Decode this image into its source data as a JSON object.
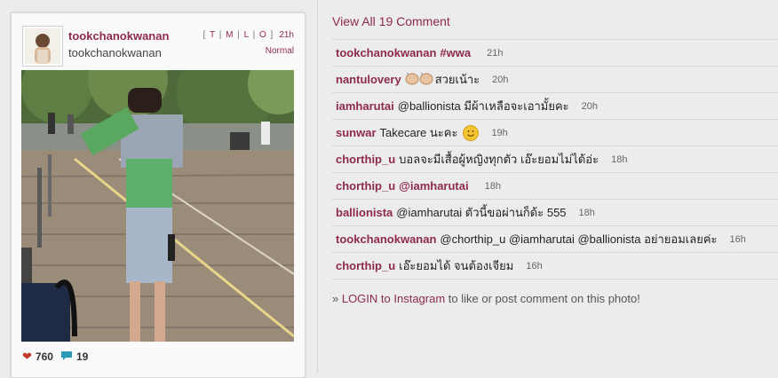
{
  "post": {
    "username": "tookchanokwanan",
    "fullname": "tookchanokwanan",
    "sizes": [
      "T",
      "M",
      "L",
      "O"
    ],
    "time": "21h",
    "filter": "Normal",
    "likes": "760",
    "comments_count": "19"
  },
  "colors": {
    "accent": "#8e2a4d",
    "heart": "#c0392b",
    "bubble": "#2a9bb5"
  },
  "view_all": "View All 19 Comment",
  "comments": [
    {
      "user": "tookchanokwanan",
      "text": "#wwa",
      "time": "21h"
    },
    {
      "user": "nantulovery",
      "text": "สวยเน้าะ",
      "time": "20h",
      "emoji": "clapping-hands-icon"
    },
    {
      "user": "iamharutai",
      "text": "@ballionista มีผ้าเหลือจะเอามั้ยคะ",
      "time": "20h"
    },
    {
      "user": "sunwar",
      "text": "Takecare นะคะ",
      "time": "19h",
      "emoji": "smiley-face-icon"
    },
    {
      "user": "chorthip_u",
      "text": "บอลจะมีเสื้อผู้หญิงทุกตัว เอ๊ะยอมไม่ได้อ่ะ",
      "time": "18h"
    },
    {
      "user": "chorthip_u",
      "text": "@iamharutai",
      "time": "18h"
    },
    {
      "user": "ballionista",
      "text": "@iamharutai ตัวนี้ขอผ่านก็ด้ะ 555",
      "time": "18h"
    },
    {
      "user": "tookchanokwanan",
      "text": "@chorthip_u @iamharutai @ballionista อย่ายอมเลยค่ะ",
      "time": "16h"
    },
    {
      "user": "chorthip_u",
      "text": "เอ๊ะยอมได้ จนต้องเจียม",
      "time": "16h"
    }
  ],
  "login": {
    "prefix": "» ",
    "link": "LOGIN to Instagram",
    "suffix": " to like or post comment on this photo!"
  }
}
